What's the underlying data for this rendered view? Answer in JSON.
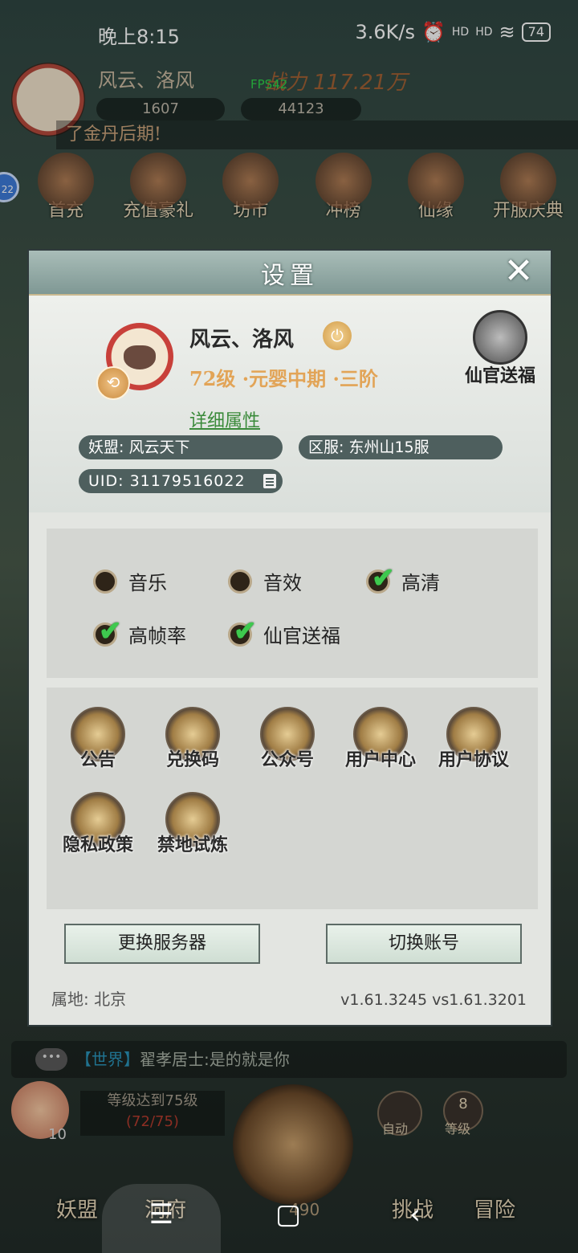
{
  "status_bar": {
    "time": "晚上8:15",
    "speed": "3.6K/s",
    "signal1": "HD",
    "signal2": "HD",
    "battery": "74"
  },
  "background": {
    "player_name": "风云、洛风",
    "fps": "FPS42",
    "power": "战力 117.21万",
    "resource1": "1607",
    "resource2": "44123",
    "banner": "了金丹后期!",
    "side_badge": "22",
    "top_icons": [
      "首充",
      "充值豪礼",
      "坊市",
      "冲榜",
      "仙缘",
      "开服庆典"
    ],
    "chat_bubble": "•••",
    "chat_channel": "【世界】",
    "chat_message": "翟孝居士:是的就是你",
    "level_goal": "等级达到75级",
    "level_progress": "(72/75)",
    "peach_count": "10",
    "auto_label": "自动",
    "level_badge": "8",
    "level_label": "等级",
    "nav_guild": "妖盟",
    "nav_cave": "洞府",
    "nav_count": "490",
    "nav_challenge": "挑战",
    "nav_adventure": "冒险"
  },
  "dialog": {
    "title": "设置",
    "close_label": "✕",
    "profile": {
      "name": "风云、洛风",
      "level": "72级 ·元婴中期 ·三阶",
      "details_link": "详细属性",
      "guild": "妖盟: 风云天下",
      "server": "区服: 东州山15服",
      "uid": "UID: 31179516022",
      "blessing_label": "仙官送福"
    },
    "options": [
      {
        "label": "音乐",
        "checked": false
      },
      {
        "label": "音效",
        "checked": false
      },
      {
        "label": "高清",
        "checked": true
      },
      {
        "label": "高帧率",
        "checked": true
      },
      {
        "label": "仙官送福",
        "checked": true
      }
    ],
    "functions": [
      "公告",
      "兑换码",
      "公众号",
      "用户中心",
      "用户协议",
      "隐私政策",
      "禁地试炼"
    ],
    "buttons": {
      "change_server": "更换服务器",
      "switch_account": "切换账号"
    },
    "footer": {
      "location": "属地: 北京",
      "version": "v1.61.3245 vs1.61.3201"
    }
  },
  "system_nav": {
    "menu": "☰",
    "home": "▢",
    "back": "‹"
  }
}
